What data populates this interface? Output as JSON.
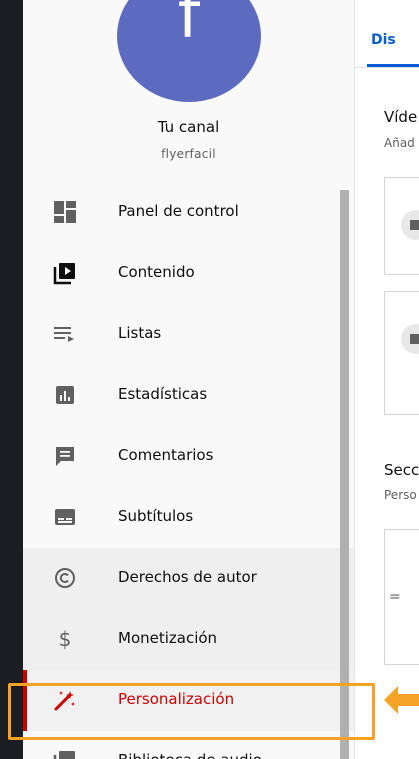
{
  "channel": {
    "avatar_letter": "f",
    "title": "Tu canal",
    "handle": "flyerfacil"
  },
  "menu": [
    {
      "label": "Panel de control",
      "icon": "dashboard-icon"
    },
    {
      "label": "Contenido",
      "icon": "content-icon"
    },
    {
      "label": "Listas",
      "icon": "playlists-icon"
    },
    {
      "label": "Estadísticas",
      "icon": "analytics-icon"
    },
    {
      "label": "Comentarios",
      "icon": "comments-icon"
    },
    {
      "label": "Subtítulos",
      "icon": "subtitles-icon"
    },
    {
      "label": "Derechos de autor",
      "icon": "copyright-icon"
    },
    {
      "label": "Monetización",
      "icon": "dollar-icon"
    },
    {
      "label": "Personalización",
      "icon": "magic-wand-icon",
      "active": true
    },
    {
      "label": "Biblioteca de audio",
      "icon": "audio-library-icon"
    }
  ],
  "main": {
    "tab_label": "Dis",
    "section1_title": "Víde",
    "section1_sub": "Añad",
    "section2_title": "Secc",
    "section2_sub": "Perso"
  },
  "colors": {
    "accent": "#cc0000",
    "highlight": "#f5a327",
    "link": "#065fd4",
    "avatar": "#5c6bc0"
  }
}
